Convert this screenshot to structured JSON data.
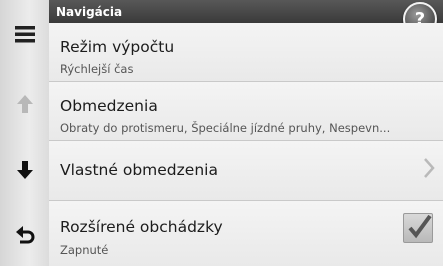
{
  "header": {
    "title": "Navigácia",
    "help_label": "?"
  },
  "rail": {
    "items": [
      {
        "icon": "menu-icon"
      },
      {
        "icon": "arrow-up-icon"
      },
      {
        "icon": "arrow-down-icon"
      },
      {
        "icon": "back-icon"
      }
    ]
  },
  "settings": [
    {
      "title": "Režim výpočtu",
      "subtitle": "Rýchlejší čas"
    },
    {
      "title": "Obmedzenia",
      "subtitle": "Obraty do protismeru, Špeciálne jízdné pruhy, Nespevn..."
    },
    {
      "title": "Vlastné obmedzenia",
      "subtitle": ""
    },
    {
      "title": "Rozšírené obchádzky",
      "subtitle": "Zapnuté",
      "checked": true
    }
  ]
}
